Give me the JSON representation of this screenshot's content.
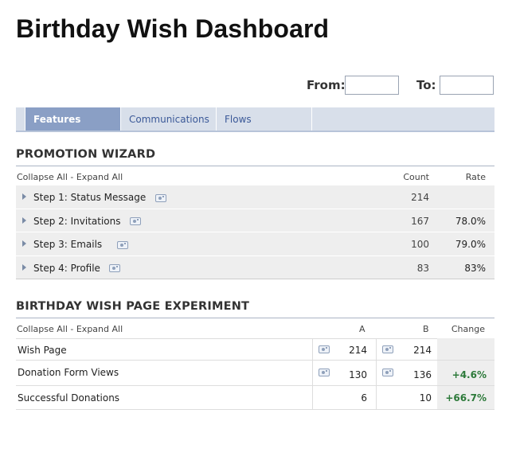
{
  "page": {
    "title": "Birthday Wish Dashboard"
  },
  "date_filter": {
    "from_label": "From:",
    "from_value": "",
    "to_label": "To:",
    "to_value": ""
  },
  "tabs": [
    {
      "label": "Features",
      "active": true
    },
    {
      "label": "Communications",
      "active": false
    },
    {
      "label": "Flows",
      "active": false
    }
  ],
  "wizard": {
    "title": "PROMOTION WIZARD",
    "collapse_label": "Collapse All",
    "separator": " - ",
    "expand_label": "Expand All",
    "col_count": "Count",
    "col_rate": "Rate",
    "rows": [
      {
        "label": "Step 1: Status Message",
        "count": "214",
        "rate": ""
      },
      {
        "label": "Step 2: Invitations",
        "count": "167",
        "rate": "78.0%"
      },
      {
        "label": "Step 3: Emails",
        "count": "100",
        "rate": "79.0%"
      },
      {
        "label": "Step 4: Profile",
        "count": "83",
        "rate": "83%"
      }
    ]
  },
  "experiment": {
    "title": "BIRTHDAY WISH PAGE EXPERIMENT",
    "collapse_label": "Collapse All",
    "separator": " - ",
    "expand_label": "Expand All",
    "col_a": "A",
    "col_b": "B",
    "col_change": "Change",
    "rows": [
      {
        "label": "Wish Page",
        "a": "214",
        "b": "214",
        "change": ""
      },
      {
        "label": "Donation Form Views",
        "a": "130",
        "b": "136",
        "change": "+4.6%"
      },
      {
        "label": "Successful Donations",
        "a": "6",
        "b": "10",
        "change": "+66.7%"
      }
    ]
  },
  "colors": {
    "accent": "#3b5998",
    "tab_active": "#8a9fc5",
    "tab_bar": "#d8dfea",
    "positive": "#2d7a3a"
  },
  "icons": {
    "step_preview": "camera-icon",
    "expand": "triangle-right-icon"
  }
}
